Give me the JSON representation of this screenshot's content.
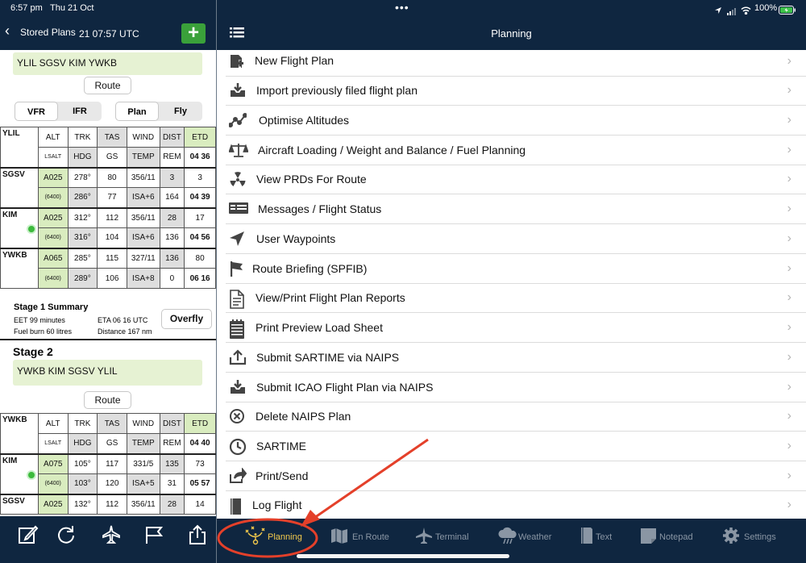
{
  "status_bar": {
    "time": "6:57 pm",
    "date": "Thu 21 Oct",
    "battery": "100%"
  },
  "left_header": {
    "back_label": "Stored Plans",
    "time_utc": "21 07:57 UTC",
    "add_label": "+"
  },
  "stage1": {
    "route": "YLIL SGSV KIM YWKB",
    "route_button": "Route",
    "rules": [
      "VFR",
      "IFR"
    ],
    "modes": [
      "Plan",
      "Fly"
    ],
    "header_row1": [
      "ALT",
      "TRK",
      "TAS",
      "WIND",
      "DIST",
      "ETD"
    ],
    "header_row2": [
      "LSALT",
      "HDG",
      "GS",
      "TEMP",
      "REM",
      "04 36"
    ],
    "origin": "YLIL",
    "legs": [
      {
        "wp": "SGSV",
        "r1": [
          "A025",
          "278°",
          "80",
          "356/11",
          "3",
          "3"
        ],
        "r2": [
          "(6400)",
          "286°",
          "77",
          "ISA+6",
          "164",
          "04 39"
        ]
      },
      {
        "wp": "KIM",
        "r1": [
          "A025",
          "312°",
          "112",
          "356/11",
          "28",
          "17"
        ],
        "r2": [
          "(6400)",
          "316°",
          "104",
          "ISA+6",
          "136",
          "04 56"
        ]
      },
      {
        "wp": "YWKB",
        "r1": [
          "A065",
          "285°",
          "115",
          "327/11",
          "136",
          "80"
        ],
        "r2": [
          "(6400)",
          "289°",
          "106",
          "ISA+8",
          "0",
          "06 16"
        ]
      }
    ],
    "summary_title": "Stage 1 Summary",
    "eet": "EET 99 minutes",
    "eta": "ETA 06 16 UTC",
    "fuel": "Fuel burn 60 litres",
    "distance": "Distance 167 nm",
    "overfly_button": "Overfly"
  },
  "stage2": {
    "title": "Stage 2",
    "route": "YWKB KIM SGSV YLIL",
    "route_button": "Route",
    "header_row1": [
      "ALT",
      "TRK",
      "TAS",
      "WIND",
      "DIST",
      "ETD"
    ],
    "header_row2": [
      "LSALT",
      "HDG",
      "GS",
      "TEMP",
      "REM",
      "04 40"
    ],
    "origin": "YWKB",
    "legs": [
      {
        "wp": "KIM",
        "r1": [
          "A075",
          "105°",
          "117",
          "331/5",
          "135",
          "73"
        ],
        "r2": [
          "(6400)",
          "103°",
          "120",
          "ISA+5",
          "31",
          "05 57"
        ]
      },
      {
        "wp": "SGSV",
        "r1": [
          "A025",
          "132°",
          "112",
          "356/11",
          "28",
          "14"
        ],
        "r2": [
          "",
          "",
          "",
          "",
          "",
          ""
        ]
      }
    ]
  },
  "right_header": {
    "title": "Planning"
  },
  "menu": [
    {
      "label": "New Flight Plan",
      "icon": "new-plan-icon"
    },
    {
      "label": "Import previously filed flight plan",
      "icon": "import-icon"
    },
    {
      "label": "Optimise Altitudes",
      "icon": "graph-icon"
    },
    {
      "label": "Aircraft Loading / Weight and Balance / Fuel Planning",
      "icon": "scales-icon"
    },
    {
      "label": "View PRDs For Route",
      "icon": "radiation-icon"
    },
    {
      "label": "Messages / Flight Status",
      "icon": "messages-icon"
    },
    {
      "label": "User Waypoints",
      "icon": "location-arrow-icon"
    },
    {
      "label": "Route Briefing (SPFIB)",
      "icon": "flag-icon"
    },
    {
      "label": "View/Print Flight Plan Reports",
      "icon": "report-icon"
    },
    {
      "label": "Print Preview Load Sheet",
      "icon": "load-sheet-icon"
    },
    {
      "label": "Submit SARTIME via NAIPS",
      "icon": "upload-icon"
    },
    {
      "label": "Submit ICAO Flight Plan via NAIPS",
      "icon": "inbox-icon"
    },
    {
      "label": "Delete NAIPS Plan",
      "icon": "delete-circle-icon"
    },
    {
      "label": "SARTIME",
      "icon": "clock-icon"
    },
    {
      "label": "Print/Send",
      "icon": "share-icon"
    },
    {
      "label": "Log Flight",
      "icon": "logbook-icon"
    }
  ],
  "tabs": [
    {
      "label": "Planning",
      "icon": "planning-icon"
    },
    {
      "label": "En Route",
      "icon": "map-icon"
    },
    {
      "label": "Terminal",
      "icon": "plane-icon"
    },
    {
      "label": "Weather",
      "icon": "cloud-icon"
    },
    {
      "label": "Text",
      "icon": "text-icon"
    },
    {
      "label": "Notepad",
      "icon": "notepad-icon"
    },
    {
      "label": "Settings",
      "icon": "gear-icon"
    }
  ],
  "colors": {
    "nav_bg": "#0f2640",
    "accent_green": "#3aa13a",
    "route_bg": "#e6f2d3",
    "annotation_red": "#e4402a",
    "active_tab": "#f2c94c"
  }
}
